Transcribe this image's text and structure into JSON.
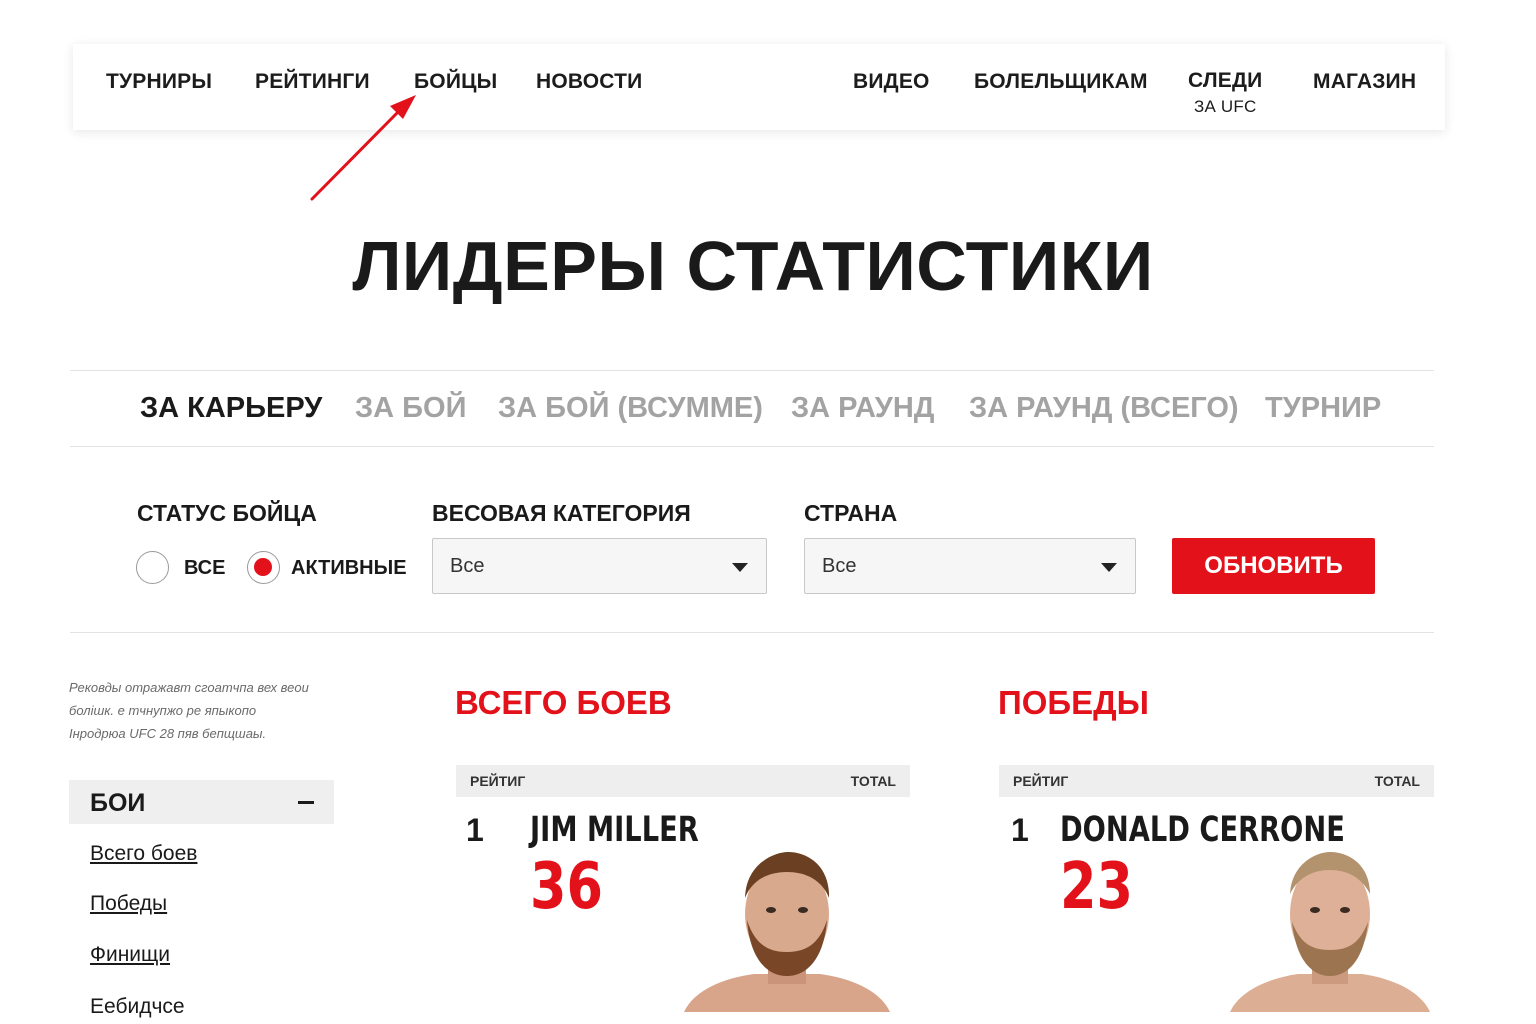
{
  "nav": {
    "left": [
      "ТУРНИРЫ",
      "РЕЙТИНГИ",
      "БОЙЦЫ",
      "НОВОСТИ"
    ],
    "right": [
      "ВИДЕО",
      "БОЛЕЛЬЩИКАМ"
    ],
    "follow_line1": "СЛЕДИ",
    "follow_line2": "ЗА UFC",
    "shop": "МАГАЗИН"
  },
  "page_title": "ЛИДЕРЫ СТАТИСТИКИ",
  "tabs": [
    "ЗА КАРЬЕРУ",
    "ЗА БОЙ",
    "ЗА БОЙ (ВСУММЕ)",
    "ЗА РАУНД",
    "ЗА РАУНД (ВСЕГО)",
    "ТУРНИР"
  ],
  "filters": {
    "status_label": "СТАТУС БОЙЦА",
    "status_all": "ВСЕ",
    "status_active": "АКТИВНЫЕ",
    "weight_label": "ВЕСОВАЯ КАТЕГОРИЯ",
    "weight_value": "Все",
    "country_label": "СТРАНА",
    "country_value": "Все",
    "update_button": "ОБНОВИТЬ"
  },
  "sidebar": {
    "note_lines": [
      "Рековды отражавт сгоатчпа вех веои",
      "болішк. е тчнупжо ре япыкопо",
      "Інродрюа UFC 28 пяв бепщшаы."
    ],
    "section_title": "БОИ",
    "links": [
      "Всего боев",
      "Победы",
      "Финищи",
      "Еебидчсе"
    ]
  },
  "cards": [
    {
      "title": "ВСЕГО БОЕВ",
      "col_rank": "РЕЙТИГ",
      "col_total": "TOTAL",
      "rank": "1",
      "name": "JIM MILLER",
      "total": "36"
    },
    {
      "title": "ПОБЕДЫ",
      "col_rank": "РЕЙТИГ",
      "col_total": "TOTAL",
      "rank": "1",
      "name": "DONALD CERRONE",
      "total": "23"
    }
  ],
  "colors": {
    "accent": "#e3111a",
    "inactive_tab": "#a3a3a3",
    "text": "#1a1a1a"
  }
}
